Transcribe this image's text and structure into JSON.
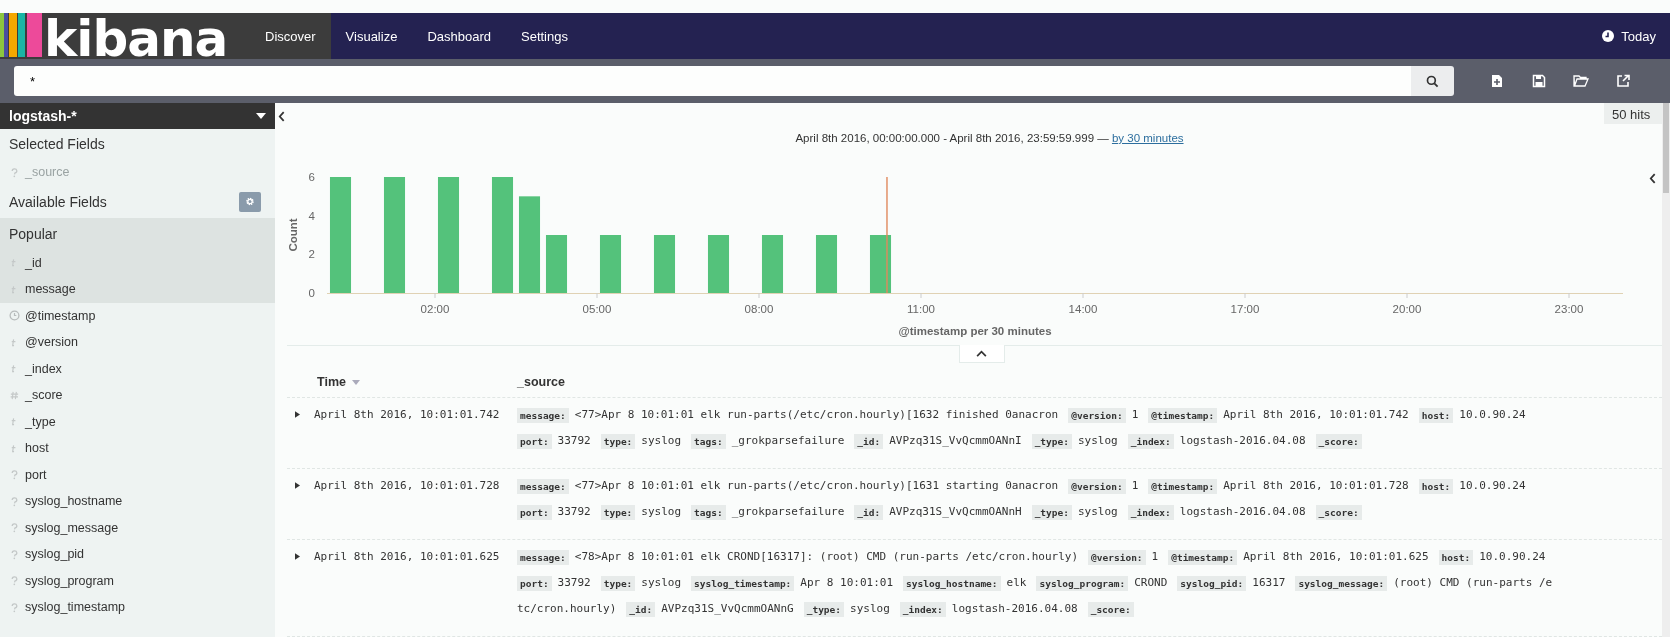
{
  "header": {
    "logo": "kibana",
    "tabs": [
      {
        "label": "Discover",
        "selected": true
      },
      {
        "label": "Visualize",
        "selected": false
      },
      {
        "label": "Dashboard",
        "selected": false
      },
      {
        "label": "Settings",
        "selected": false
      }
    ],
    "time_picker": "Today"
  },
  "search": {
    "value": "*"
  },
  "sidebar": {
    "index_pattern": "logstash-*",
    "selected_heading": "Selected Fields",
    "selected_fields": [
      {
        "name": "_source",
        "kind": "unknown"
      }
    ],
    "available_heading": "Available Fields",
    "popular_heading": "Popular",
    "popular_fields": [
      {
        "name": "_id",
        "kind": "string"
      },
      {
        "name": "message",
        "kind": "string"
      }
    ],
    "fields": [
      {
        "name": "@timestamp",
        "kind": "date"
      },
      {
        "name": "@version",
        "kind": "string"
      },
      {
        "name": "_index",
        "kind": "string"
      },
      {
        "name": "_score",
        "kind": "number"
      },
      {
        "name": "_type",
        "kind": "string"
      },
      {
        "name": "host",
        "kind": "string"
      },
      {
        "name": "port",
        "kind": "unknown"
      },
      {
        "name": "syslog_hostname",
        "kind": "unknown"
      },
      {
        "name": "syslog_message",
        "kind": "unknown"
      },
      {
        "name": "syslog_pid",
        "kind": "unknown"
      },
      {
        "name": "syslog_program",
        "kind": "unknown"
      },
      {
        "name": "syslog_timestamp",
        "kind": "unknown"
      }
    ]
  },
  "hits": "50 hits",
  "histogram": {
    "range": "April 8th 2016, 00:00:00.000 - April 8th 2016, 23:59:59.999 — ",
    "interval_link": "by 30 minutes",
    "chart_data": {
      "type": "bar",
      "xlabel": "@timestamp per 30 minutes",
      "ylabel": "Count",
      "x": [
        0.25,
        1.25,
        2.25,
        3.25,
        3.75,
        4.25,
        5.25,
        6.25,
        7.25,
        8.25,
        9.25,
        10.25
      ],
      "values": [
        6,
        6,
        6,
        6,
        5,
        3,
        3,
        3,
        3,
        3,
        3,
        3
      ],
      "xlim": [
        0,
        24
      ],
      "ylim": [
        0,
        6
      ],
      "xticks": [
        {
          "value": 2,
          "label": "02:00"
        },
        {
          "value": 5,
          "label": "05:00"
        },
        {
          "value": 8,
          "label": "08:00"
        },
        {
          "value": 11,
          "label": "11:00"
        },
        {
          "value": 14,
          "label": "14:00"
        },
        {
          "value": 17,
          "label": "17:00"
        },
        {
          "value": 20,
          "label": "20:00"
        },
        {
          "value": 23,
          "label": "23:00"
        }
      ],
      "yticks": [
        0,
        2,
        4,
        6
      ],
      "ref_lines": [
        {
          "axis": "x",
          "value": 10.37
        }
      ]
    }
  },
  "table": {
    "columns": [
      "Time",
      "_source"
    ],
    "rows": [
      {
        "time": "April 8th 2016, 10:01:01.742",
        "lines": [
          [
            {
              "key": "message:",
              "value": "<77>Apr 8 10:01:01 elk run-parts(/etc/cron.hourly)[1632 finished 0anacron"
            },
            {
              "key": "@version:",
              "value": "1"
            },
            {
              "key": "@timestamp:",
              "value": "April 8th 2016, 10:01:01.742"
            },
            {
              "key": "host:",
              "value": "10.0.90.24"
            }
          ],
          [
            {
              "key": "port:",
              "value": "33792"
            },
            {
              "key": "type:",
              "value": "syslog"
            },
            {
              "key": "tags:",
              "value": "_grokparsefailure"
            },
            {
              "key": "_id:",
              "value": "AVPzq31S_VvQcmmOANnI"
            },
            {
              "key": "_type:",
              "value": "syslog"
            },
            {
              "key": "_index:",
              "value": "logstash-2016.04.08"
            },
            {
              "key": "_score:"
            }
          ]
        ]
      },
      {
        "time": "April 8th 2016, 10:01:01.728",
        "lines": [
          [
            {
              "key": "message:",
              "value": "<77>Apr 8 10:01:01 elk run-parts(/etc/cron.hourly)[1631 starting 0anacron"
            },
            {
              "key": "@version:",
              "value": "1"
            },
            {
              "key": "@timestamp:",
              "value": "April 8th 2016, 10:01:01.728"
            },
            {
              "key": "host:",
              "value": "10.0.90.24"
            }
          ],
          [
            {
              "key": "port:",
              "value": "33792"
            },
            {
              "key": "type:",
              "value": "syslog"
            },
            {
              "key": "tags:",
              "value": "_grokparsefailure"
            },
            {
              "key": "_id:",
              "value": "AVPzq31S_VvQcmmOANnH"
            },
            {
              "key": "_type:",
              "value": "syslog"
            },
            {
              "key": "_index:",
              "value": "logstash-2016.04.08"
            },
            {
              "key": "_score:"
            }
          ]
        ]
      },
      {
        "time": "April 8th 2016, 10:01:01.625",
        "lines": [
          [
            {
              "key": "message:",
              "value": "<78>Apr 8 10:01:01 elk CROND[16317]: (root) CMD (run-parts /etc/cron.hourly)"
            },
            {
              "key": "@version:",
              "value": "1"
            },
            {
              "key": "@timestamp:",
              "value": "April 8th 2016, 10:01:01.625"
            },
            {
              "key": "host:",
              "value": "10.0.90.24"
            }
          ],
          [
            {
              "key": "port:",
              "value": "33792"
            },
            {
              "key": "type:",
              "value": "syslog"
            },
            {
              "key": "syslog_timestamp:",
              "value": "Apr 8 10:01:01"
            },
            {
              "key": "syslog_hostname:",
              "value": "elk"
            },
            {
              "key": "syslog_program:",
              "value": "CROND"
            },
            {
              "key": "syslog_pid:",
              "value": "16317"
            },
            {
              "key": "syslog_message:",
              "value": "(root) CMD (run-parts /e"
            }
          ],
          [
            {
              "value": "tc/cron.hourly)"
            },
            {
              "key": "_id:",
              "value": "AVPzq31S_VvQcmmOANnG"
            },
            {
              "key": "_type:",
              "value": "syslog"
            },
            {
              "key": "_index:",
              "value": "logstash-2016.04.08"
            },
            {
              "key": "_score:"
            }
          ]
        ]
      }
    ]
  }
}
